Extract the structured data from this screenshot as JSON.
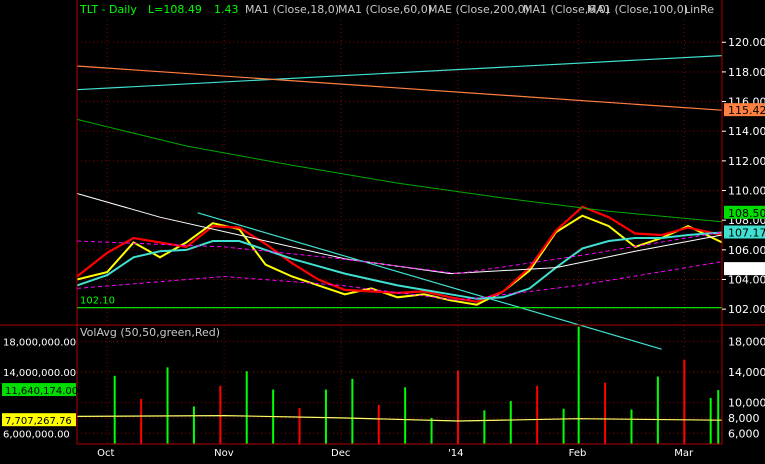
{
  "header": {
    "symbol_label": "TLT - Daily",
    "last_label": "L=108.49",
    "change_label": "1.43",
    "studies": [
      "MA1 (Close,18,0)",
      "MA1 (Close,60,0)",
      "MAE (Close,200,0)",
      "MA1 (Close,6,0)",
      "MA1 (Close,100,0)",
      "LinRe"
    ]
  },
  "colors": {
    "background": "#000000",
    "grid": "#8b0000",
    "price_up": "#00ff00",
    "price_down": "#ff0000",
    "ma6": "#ffff00",
    "ma18": "#ff0000",
    "ma60": "#40e0d0",
    "ma100": "#ffffff",
    "ma200": "#00aa00",
    "envelope": "#ff00ff",
    "linreg_upper": "#40e0d0",
    "linreg_lower": "#ff8040",
    "support": "#00ff00",
    "volume_avg": "#ffff66"
  },
  "chart_data": [
    {
      "type": "line",
      "panel": "price",
      "title": "TLT - Daily",
      "x_ticks": [
        "Oct",
        "Nov",
        "Dec",
        "'14",
        "Feb",
        "Mar"
      ],
      "x_tick_dates": [
        "2013-10-01",
        "2013-11-01",
        "2013-12-02",
        "2014-01-02",
        "2014-02-03",
        "2014-03-03"
      ],
      "x_range": [
        "2013-09-23",
        "2014-03-13"
      ],
      "ylim": [
        101,
        121.5
      ],
      "y_ticks": [
        102,
        104,
        106,
        108,
        110,
        112,
        114,
        116,
        118,
        120
      ],
      "y_tick_labels": [
        "102.00",
        "104.00",
        "106.00",
        "108.00",
        "110.00",
        "112.00",
        "114.00",
        "116.00",
        "118.00",
        "120.00"
      ],
      "grid": true,
      "tags": [
        {
          "label": "115.42",
          "value": 115.42,
          "color": "#ff8040"
        },
        {
          "label": "108.50",
          "value": 108.5,
          "color": "#00dd00"
        },
        {
          "label": "107.17",
          "value": 107.17,
          "color": "#40e0d0"
        },
        {
          "label": "",
          "value": 104.7,
          "color": "#ffffff"
        }
      ],
      "annotations": [
        {
          "label": "102.10",
          "value": 102.1
        }
      ],
      "series": [
        {
          "name": "MA1 (Close,6,0)",
          "color": "#ffff00",
          "x": [
            "2013-09-23",
            "2013-10-01",
            "2013-10-08",
            "2013-10-15",
            "2013-10-22",
            "2013-10-29",
            "2013-11-05",
            "2013-11-12",
            "2013-11-19",
            "2013-11-26",
            "2013-12-03",
            "2013-12-10",
            "2013-12-17",
            "2013-12-24",
            "2013-12-31",
            "2014-01-07",
            "2014-01-14",
            "2014-01-21",
            "2014-01-28",
            "2014-02-04",
            "2014-02-11",
            "2014-02-18",
            "2014-02-25",
            "2014-03-04",
            "2014-03-13"
          ],
          "values": [
            104,
            104.5,
            106.5,
            105.5,
            106.5,
            107.8,
            107.4,
            105,
            104.2,
            103.6,
            103,
            103.4,
            102.8,
            103,
            102.6,
            102.3,
            103.2,
            104.6,
            107.2,
            108.3,
            107.6,
            106.2,
            106.8,
            107.6,
            106.5
          ]
        },
        {
          "name": "MA1 (Close,18,0)",
          "color": "#ff0000",
          "x": [
            "2013-09-23",
            "2013-10-01",
            "2013-10-08",
            "2013-10-15",
            "2013-10-22",
            "2013-10-29",
            "2013-11-05",
            "2013-11-12",
            "2013-11-19",
            "2013-11-26",
            "2013-12-03",
            "2013-12-10",
            "2013-12-17",
            "2013-12-24",
            "2013-12-31",
            "2014-01-07",
            "2014-01-14",
            "2014-01-21",
            "2014-01-28",
            "2014-02-04",
            "2014-02-11",
            "2014-02-18",
            "2014-02-25",
            "2014-03-04",
            "2014-03-13"
          ],
          "values": [
            104.2,
            105.8,
            106.8,
            106.5,
            106.2,
            107.6,
            107.5,
            106.4,
            105.1,
            104,
            103.3,
            103.2,
            103.1,
            103.2,
            102.8,
            102.5,
            103.2,
            104.8,
            107.3,
            108.9,
            108.2,
            107.1,
            107,
            107.5,
            107
          ]
        },
        {
          "name": "MA1 (Close,60,0)",
          "color": "#40e0d0",
          "x": [
            "2013-09-23",
            "2013-10-01",
            "2013-10-08",
            "2013-10-15",
            "2013-10-22",
            "2013-10-29",
            "2013-11-05",
            "2013-11-12",
            "2013-11-19",
            "2013-11-26",
            "2013-12-03",
            "2013-12-10",
            "2013-12-17",
            "2013-12-24",
            "2013-12-31",
            "2014-01-07",
            "2014-01-14",
            "2014-01-21",
            "2014-01-28",
            "2014-02-04",
            "2014-02-11",
            "2014-02-18",
            "2014-02-25",
            "2014-03-04",
            "2014-03-13"
          ],
          "values": [
            103.6,
            104.3,
            105.5,
            105.9,
            106,
            106.6,
            106.6,
            106,
            105.4,
            104.9,
            104.4,
            104,
            103.6,
            103.3,
            103,
            102.7,
            102.8,
            103.4,
            104.8,
            106.1,
            106.6,
            106.8,
            106.8,
            107,
            107.17
          ]
        },
        {
          "name": "MA1 (Close,100,0)",
          "color": "#ffffff",
          "x": [
            "2013-09-23",
            "2013-10-15",
            "2013-11-05",
            "2013-12-03",
            "2013-12-31",
            "2014-01-28",
            "2014-02-18",
            "2014-03-13"
          ],
          "values": [
            109.8,
            108.2,
            107,
            105.4,
            104.4,
            104.8,
            105.9,
            107
          ]
        },
        {
          "name": "MAE (Close,200,0)",
          "color": "#00aa00",
          "x": [
            "2013-09-23",
            "2013-10-22",
            "2013-11-19",
            "2013-12-17",
            "2014-01-14",
            "2014-02-11",
            "2014-03-13"
          ],
          "values": [
            114.8,
            113,
            111.7,
            110.5,
            109.5,
            108.6,
            107.9
          ]
        },
        {
          "name": "LinRe upper",
          "color": "#40e0d0",
          "x": [
            "2013-09-23",
            "2014-03-13"
          ],
          "values": [
            116.8,
            119.1
          ]
        },
        {
          "name": "LinRe lower",
          "color": "#ff8040",
          "x": [
            "2013-09-23",
            "2014-03-13"
          ],
          "values": [
            118.4,
            115.42
          ]
        },
        {
          "name": "Trendline",
          "color": "#40e0d0",
          "x": [
            "2013-10-25",
            "2014-02-25"
          ],
          "values": [
            108.5,
            99.3
          ]
        },
        {
          "name": "Envelope upper",
          "color": "#ff00ff",
          "x": [
            "2013-09-23",
            "2013-11-01",
            "2013-12-02",
            "2014-01-02",
            "2014-02-03",
            "2014-03-13"
          ],
          "values": [
            106.6,
            106.2,
            105.4,
            104.4,
            105.6,
            107.2
          ]
        },
        {
          "name": "Envelope lower",
          "color": "#ff00ff",
          "x": [
            "2013-09-23",
            "2013-11-01",
            "2013-12-02",
            "2014-01-02",
            "2014-02-03",
            "2014-03-13"
          ],
          "values": [
            103.4,
            104.2,
            103.6,
            102.6,
            103.6,
            105.2
          ]
        },
        {
          "name": "Support 102.10",
          "color": "#00ff00",
          "x": [
            "2013-09-23",
            "2014-03-13"
          ],
          "values": [
            102.1,
            102.1
          ]
        }
      ]
    },
    {
      "type": "bar",
      "panel": "volume",
      "title": "VolAvg (50,50,green,Red)",
      "x_range": [
        "2013-09-23",
        "2014-03-13"
      ],
      "ylim": [
        4600000,
        20000000
      ],
      "y_ticks": [
        6000000,
        8000000,
        10000000,
        14000000,
        18000000
      ],
      "y_tick_labels_right": [
        "6,000",
        "8,000",
        "10,000",
        "14,000",
        "18,000"
      ],
      "y_tick_labels_left": [
        "6,000,000.00",
        "14,000,000.00",
        "18,000,000.00"
      ],
      "tags": [
        {
          "label": "11,640,174.00",
          "value": 11640174,
          "color": "#00dd00"
        },
        {
          "label": "7,707,267.76",
          "value": 7707268,
          "color": "#ffff00"
        }
      ],
      "series": [
        {
          "name": "Volume",
          "x": [
            "2013-10-03",
            "2013-10-10",
            "2013-10-17",
            "2013-10-24",
            "2013-10-31",
            "2013-11-07",
            "2013-11-14",
            "2013-11-21",
            "2013-11-28",
            "2013-12-05",
            "2013-12-12",
            "2013-12-19",
            "2013-12-26",
            "2014-01-02",
            "2014-01-09",
            "2014-01-16",
            "2014-01-23",
            "2014-01-30",
            "2014-02-03",
            "2014-02-10",
            "2014-02-17",
            "2014-02-24",
            "2014-03-03",
            "2014-03-10",
            "2014-03-12"
          ],
          "values": [
            13500000,
            10500000,
            14600000,
            9500000,
            12200000,
            14100000,
            11700000,
            9300000,
            11700000,
            13100000,
            9700000,
            12000000,
            8000000,
            14200000,
            9000000,
            10200000,
            12200000,
            9200000,
            19900000,
            12600000,
            9100000,
            13400000,
            15600000,
            10600000,
            11640174
          ]
        },
        {
          "name": "VolAvg",
          "color": "#ffff66",
          "x": [
            "2013-09-23",
            "2013-11-01",
            "2013-12-02",
            "2014-01-02",
            "2014-02-03",
            "2014-03-13"
          ],
          "values": [
            8200000,
            8300000,
            8000000,
            7600000,
            7900000,
            7707268
          ]
        }
      ]
    }
  ]
}
